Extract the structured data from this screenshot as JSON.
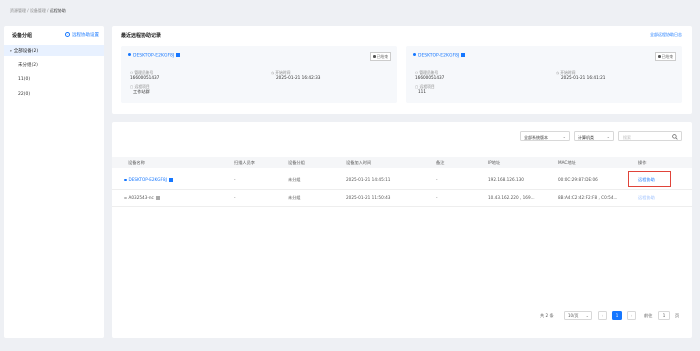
{
  "breadcrumb": {
    "items": [
      "资源管理",
      "设备管理",
      "远程协助"
    ]
  },
  "sidebar": {
    "title": "设备分组",
    "settings_link": "远程协助设置",
    "groups": [
      {
        "label": "全部设备(2)"
      },
      {
        "label": "未分组(2)"
      },
      {
        "label": "11(0)"
      },
      {
        "label": "22(0)"
      }
    ]
  },
  "recent": {
    "title": "最近远程协助记录",
    "all_link": "全部远程协助日志",
    "cards": [
      {
        "host": "DESKTOP-E2KGF8J",
        "status": "已结束",
        "admin_label": "管理员账号",
        "admin_value": "16600051437",
        "time_label": "开始时间",
        "time_value": "2025-01-21 16:42:33",
        "group_label": "远程项目",
        "group_value": "工作站群"
      },
      {
        "host": "DESKTOP-E2KGF8J",
        "status": "已结束",
        "admin_label": "管理员账号",
        "admin_value": "16600051437",
        "time_label": "开始时间",
        "time_value": "2025-01-21 16:41:21",
        "group_label": "远程项目",
        "group_value": "111"
      }
    ]
  },
  "filters": {
    "version": "全部系统版本",
    "type": "计算机类",
    "search_placeholder": "搜索"
  },
  "table": {
    "columns": [
      "设备名称",
      "扫描人员李",
      "设备分组",
      "设备加入时间",
      "备注",
      "IP地址",
      "MAC地址",
      "操作"
    ],
    "rows": [
      {
        "name": "DESKTOP-E2KGF8J",
        "scanner": "-",
        "group": "未分组",
        "joined": "2025-01-21 14:45:11",
        "note": "-",
        "ip": "192.168.126.130",
        "mac": "00:0C:29:87:DE:06",
        "action": "远程协助"
      },
      {
        "name": "A032543-nc",
        "scanner": "-",
        "group": "未分组",
        "joined": "2025-01-21 11:50:43",
        "note": "-",
        "ip": "10.43.162.220 , 169...",
        "mac": "8B:A4:C2:42:F2:F8 , C0:54...",
        "action": "远程协助"
      }
    ]
  },
  "pagination": {
    "total": "共 2 条",
    "page_size": "10/页",
    "prev": "‹",
    "current": "1",
    "next": "›",
    "goto_label": "前往",
    "goto_value": "1",
    "page_unit": "页"
  },
  "colors": {
    "accent": "#1677ff",
    "highlight": "#e0443a"
  }
}
